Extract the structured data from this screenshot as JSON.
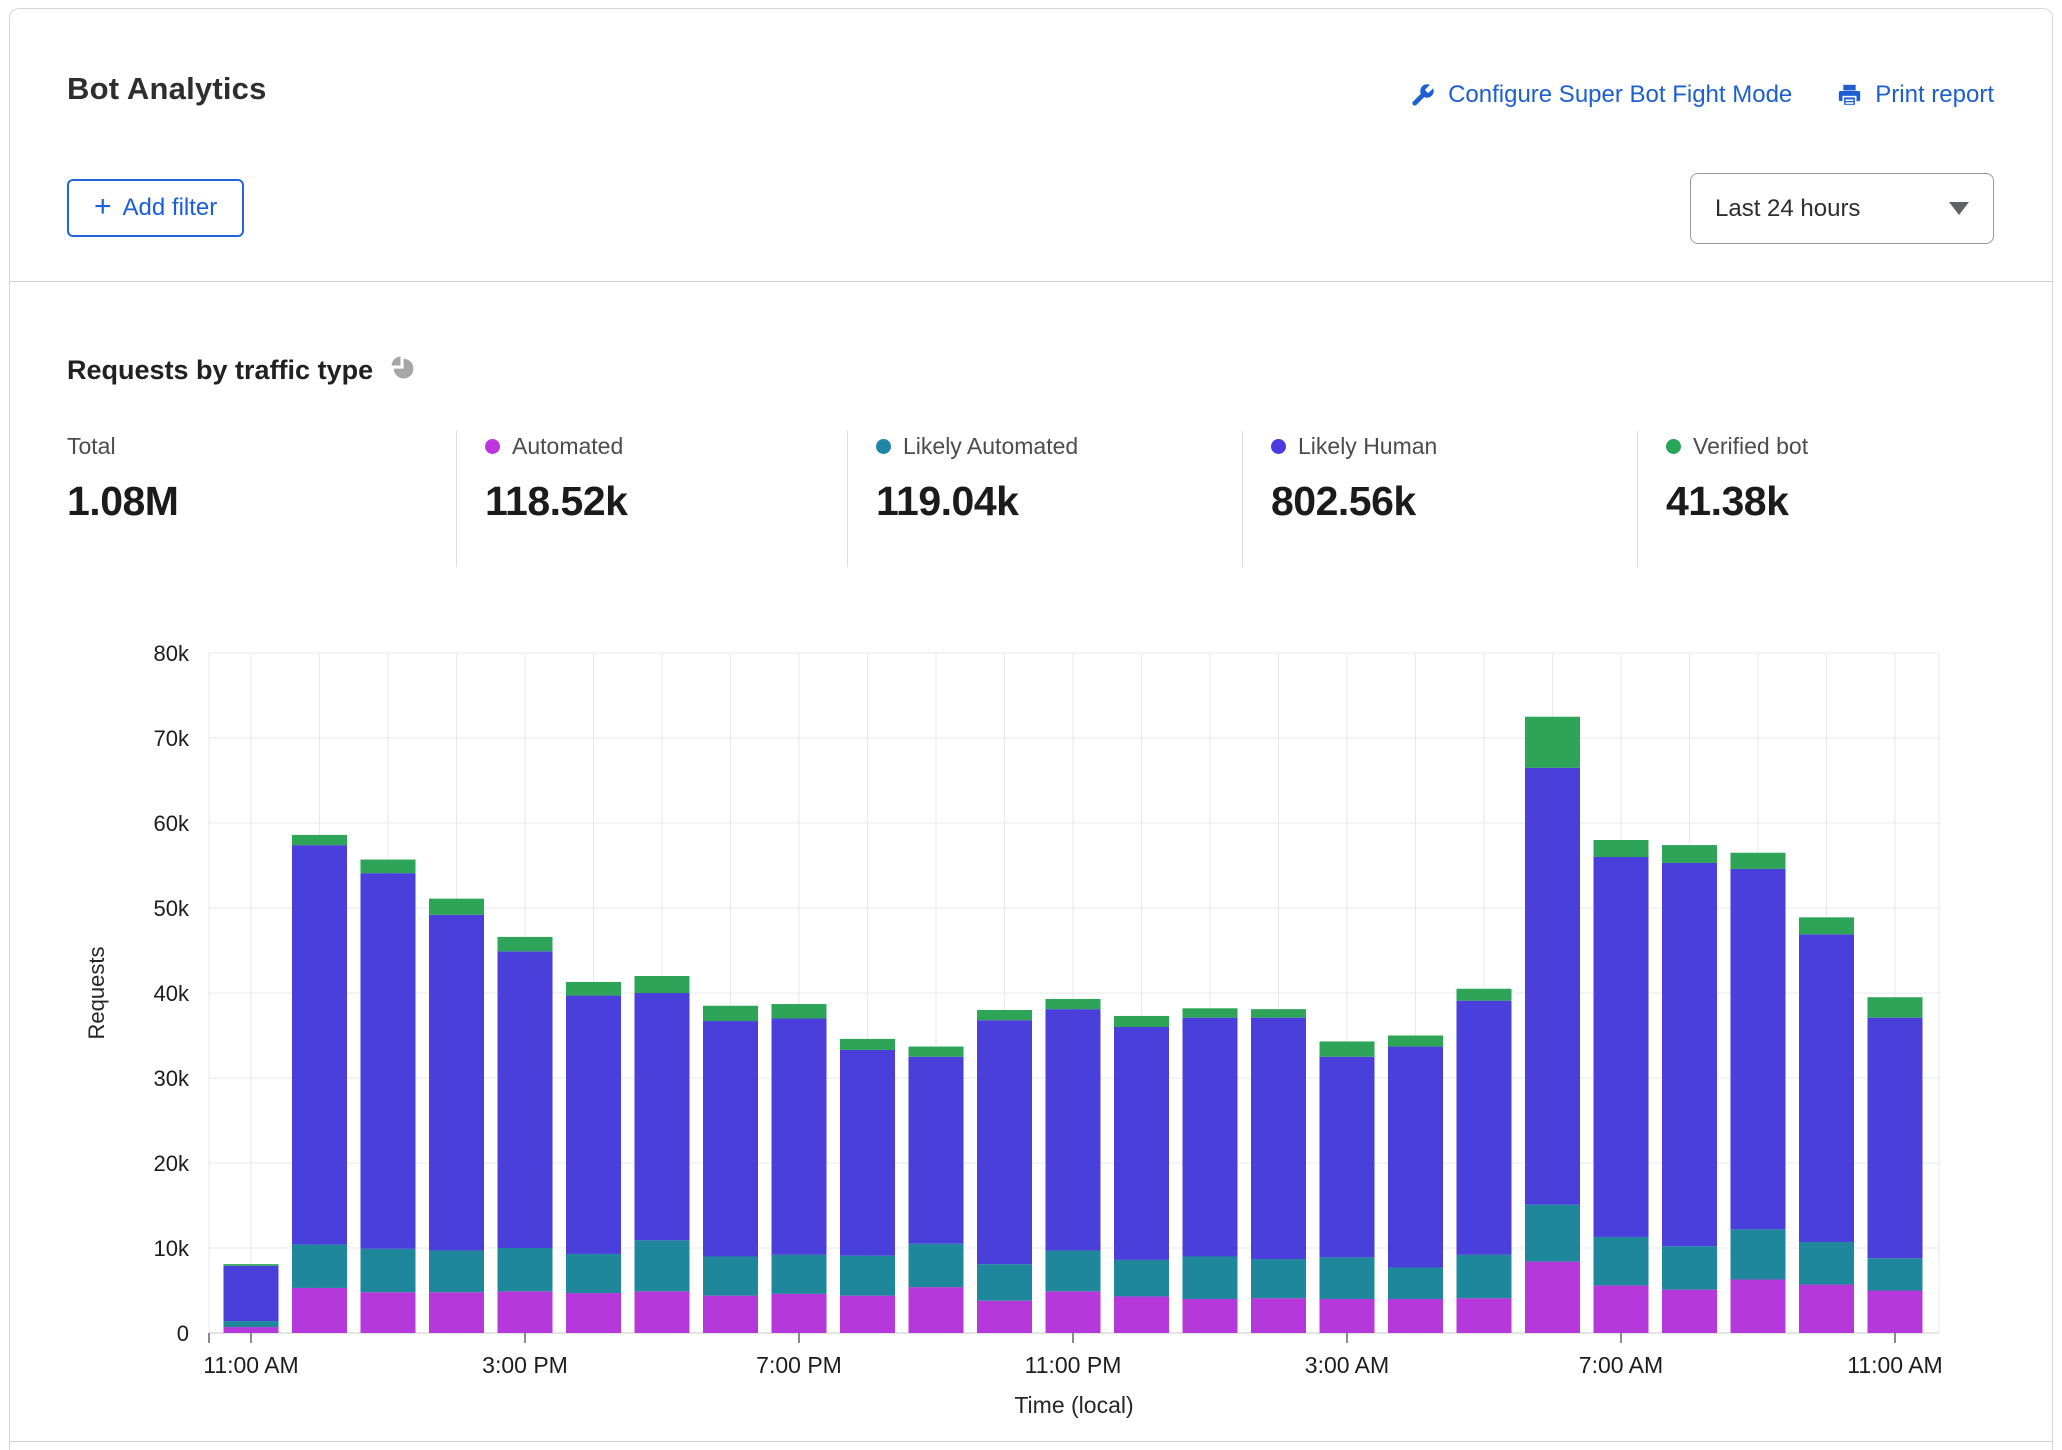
{
  "header": {
    "title": "Bot Analytics",
    "configure_label": "Configure Super Bot Fight Mode",
    "print_label": "Print report",
    "add_filter_label": "Add filter",
    "time_range_value": "Last 24 hours"
  },
  "section": {
    "heading": "Requests by traffic type"
  },
  "colors": {
    "link_blue": "#1d5ed2",
    "automated": "#b438da",
    "likely_automated": "#1e879b",
    "likely_human": "#4a3fdb",
    "verified_bot": "#2da457",
    "grid": "#e8e8e8",
    "axis": "#c9c9c9"
  },
  "stats": {
    "items": [
      {
        "label": "Total",
        "value": "1.08M",
        "color": null
      },
      {
        "label": "Automated",
        "value": "118.52k",
        "color": "#bd36dd"
      },
      {
        "label": "Likely Automated",
        "value": "119.04k",
        "color": "#1f87a4"
      },
      {
        "label": "Likely Human",
        "value": "802.56k",
        "color": "#4b3ae0"
      },
      {
        "label": "Verified bot",
        "value": "41.38k",
        "color": "#27a65a"
      }
    ]
  },
  "chart_data": {
    "type": "bar",
    "stacked": true,
    "title": "Requests by traffic type",
    "xlabel": "Time (local)",
    "ylabel": "Requests",
    "y_ticks": [
      "0",
      "10k",
      "20k",
      "30k",
      "40k",
      "50k",
      "60k",
      "70k",
      "80k"
    ],
    "ylim_k": [
      0,
      80
    ],
    "grid": true,
    "units": "thousands of requests per hour",
    "bar_count": 25,
    "x_tick_indices": [
      0,
      4,
      8,
      12,
      16,
      20,
      24
    ],
    "x_tick_labels": [
      "11:00 AM",
      "3:00 PM",
      "7:00 PM",
      "11:00 PM",
      "3:00 AM",
      "7:00 AM",
      "11:00 AM"
    ],
    "series": [
      {
        "name": "Automated",
        "color": "#b438da",
        "values_k": [
          0.7,
          5.3,
          4.8,
          4.8,
          4.9,
          4.7,
          4.9,
          4.4,
          4.6,
          4.4,
          5.4,
          3.8,
          4.9,
          4.3,
          4.0,
          4.1,
          4.0,
          4.0,
          4.1,
          8.4,
          5.6,
          5.1,
          6.3,
          5.7,
          5.0
        ]
      },
      {
        "name": "Likely Automated",
        "color": "#1e879b",
        "values_k": [
          0.7,
          5.1,
          5.1,
          4.9,
          5.1,
          4.6,
          6.0,
          4.6,
          4.6,
          4.7,
          5.1,
          4.3,
          4.8,
          4.3,
          5.0,
          4.6,
          4.9,
          3.7,
          5.1,
          6.7,
          5.7,
          5.1,
          5.9,
          5.0,
          3.8
        ]
      },
      {
        "name": "Likely Human",
        "color": "#4a3fdb",
        "values_k": [
          6.5,
          47.0,
          44.2,
          39.5,
          34.9,
          30.4,
          29.1,
          27.7,
          27.8,
          24.2,
          22.0,
          28.7,
          28.4,
          27.4,
          28.1,
          28.4,
          23.6,
          26.0,
          29.9,
          51.4,
          44.7,
          45.1,
          42.4,
          36.2,
          28.3
        ]
      },
      {
        "name": "Verified bot",
        "color": "#2da457",
        "values_k": [
          0.2,
          1.2,
          1.6,
          1.9,
          1.7,
          1.6,
          2.0,
          1.8,
          1.7,
          1.3,
          1.2,
          1.2,
          1.2,
          1.3,
          1.1,
          1.0,
          1.8,
          1.3,
          1.4,
          6.0,
          2.0,
          2.1,
          1.9,
          2.0,
          2.4
        ]
      }
    ]
  }
}
